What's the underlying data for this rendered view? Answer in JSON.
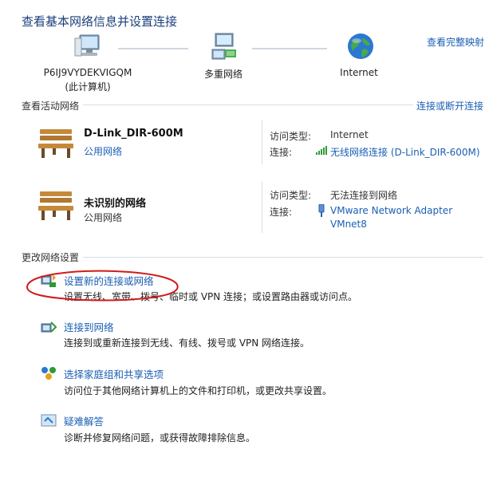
{
  "header": {
    "title": "查看基本网络信息并设置连接",
    "full_map_link": "查看完整映射"
  },
  "network_map": {
    "computer_name": "P6IJ9VYDEKVIGQM",
    "computer_subtitle": "(此计算机)",
    "network_label": "多重网络",
    "internet_label": "Internet"
  },
  "active_networks": {
    "heading": "查看活动网络",
    "connect_link": "连接或断开连接",
    "networks": [
      {
        "name": "D-Link_DIR-600M",
        "type": "公用网络",
        "access_label": "访问类型:",
        "access_value": "Internet",
        "connection_label": "连接:",
        "connection_value": "无线网络连接 (D-Link_DIR-600M)"
      },
      {
        "name": "未识别的网络",
        "type": "公用网络",
        "access_label": "访问类型:",
        "access_value": "无法连接到网络",
        "connection_label": "连接:",
        "connection_value_line1": "VMware Network Adapter",
        "connection_value_line2": "VMnet8"
      }
    ]
  },
  "change_settings": {
    "heading": "更改网络设置",
    "tasks": [
      {
        "title": "设置新的连接或网络",
        "desc": "设置无线、宽带、拨号、临时或 VPN 连接；或设置路由器或访问点。"
      },
      {
        "title": "连接到网络",
        "desc": "连接到或重新连接到无线、有线、拨号或 VPN 网络连接。"
      },
      {
        "title": "选择家庭组和共享选项",
        "desc": "访问位于其他网络计算机上的文件和打印机，或更改共享设置。"
      },
      {
        "title": "疑难解答",
        "desc": "诊断并修复网络问题，或获得故障排除信息。"
      }
    ]
  },
  "colors": {
    "link": "#1a5fb4",
    "title": "#1a3f7a",
    "annotation": "#d01b1b"
  }
}
